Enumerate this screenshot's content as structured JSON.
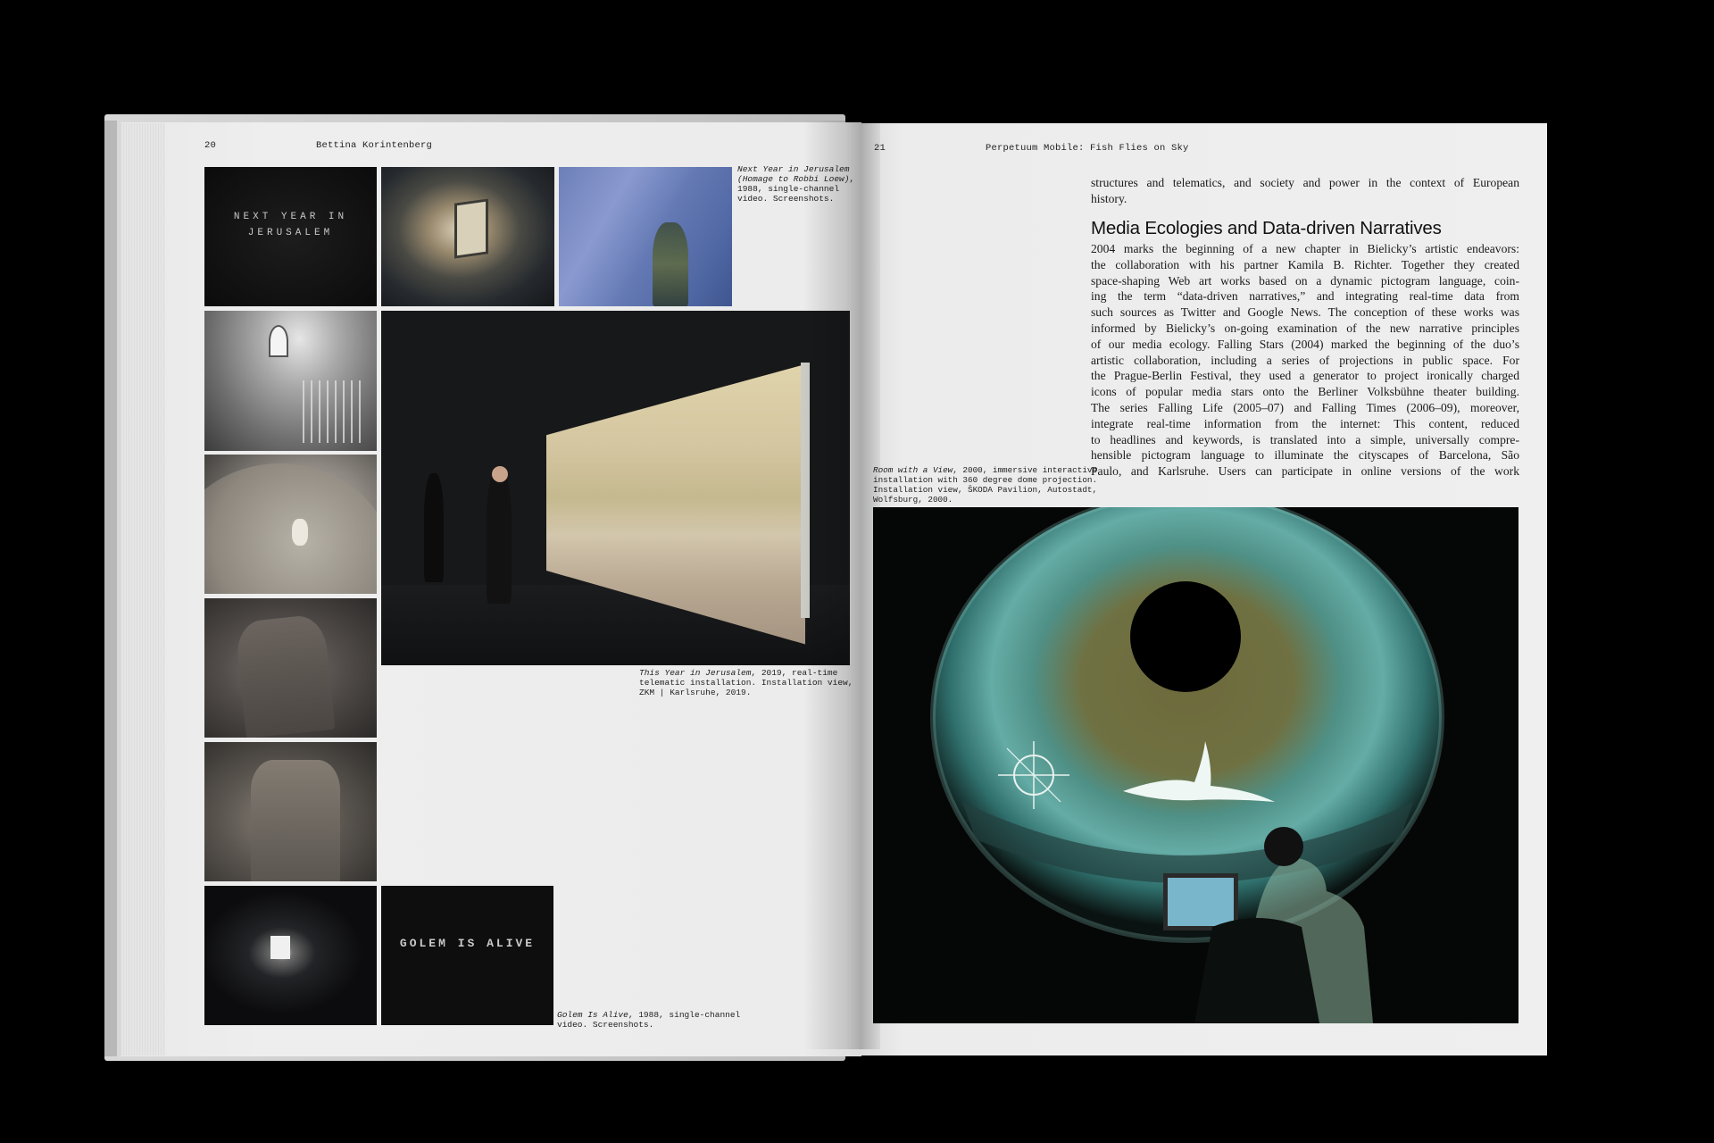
{
  "left_page": {
    "folio": "20",
    "running_head": "Bettina Korintenberg",
    "images": {
      "nyij_title_text": [
        "NEXT YEAR IN",
        "JERUSALEM"
      ],
      "golem_title_text": "GOLEM IS ALIVE"
    },
    "captions": {
      "next_year": {
        "title": "Next Year in Jerusalem",
        "line2": "(Homage to Robbi Loew)",
        "line3": "1988, single-channel",
        "line4": "video. Screenshots."
      },
      "this_year": {
        "line1_title": "This Year in Jerusalem",
        "line1_rest": ", 2019, real-time",
        "line2": "telematic installation. Installation view,",
        "line3": "ZKM | Karlsruhe, 2019."
      },
      "golem": {
        "line1_title": "Golem Is Alive",
        "line1_rest": ", 1988, single-channel",
        "line2": "video. Screenshots."
      }
    }
  },
  "right_page": {
    "folio": "21",
    "running_head": "Perpetuum Mobile: Fish Flies on Sky",
    "intro_lines": [
      "structures and telematics, and society and power in the context of European",
      "history."
    ],
    "section_heading": "Media Ecologies and Data-driven Narratives",
    "body_lines": [
      "2004 marks the beginning of a new chapter in Bielicky’s artistic endeavors:",
      "the collaboration with his partner Kamila B. Richter. Together they created",
      "space-shaping Web art works based on a dynamic pictogram language, coin-",
      "ing the term “data-driven narratives,” and integrating real-time data from",
      "such sources as Twitter and Google News. The conception of these works was",
      "informed by Bielicky’s on-going examination of the new narrative principles",
      "of our media ecology. Falling Stars (2004) marked the beginning of the duo’s",
      "artistic collaboration, including a series of projections in public space. For",
      "the Prague-Berlin Festival, they used a generator to project ironically charged",
      "icons of popular media stars onto the Berliner Volksbühne theater building.",
      "The series Falling Life (2005–07) and Falling Times (2006–09), moreover,",
      "integrate real-time information from the internet: This content, reduced",
      "to headlines and keywords, is translated into a simple, universally compre-",
      "hensible pictogram language to illuminate the cityscapes of Barcelona, São",
      "Paulo, and Karlsruhe. Users can participate in online versions of the work"
    ],
    "caption_room": {
      "line1_title": "Room with a View",
      "line1_rest": ", 2000, immersive interactive",
      "line2": "installation with 360 degree dome projection.",
      "line3": "Installation view, ŠKODA Pavilion, Autostadt,",
      "line4": "Wolfsburg, 2000."
    }
  }
}
